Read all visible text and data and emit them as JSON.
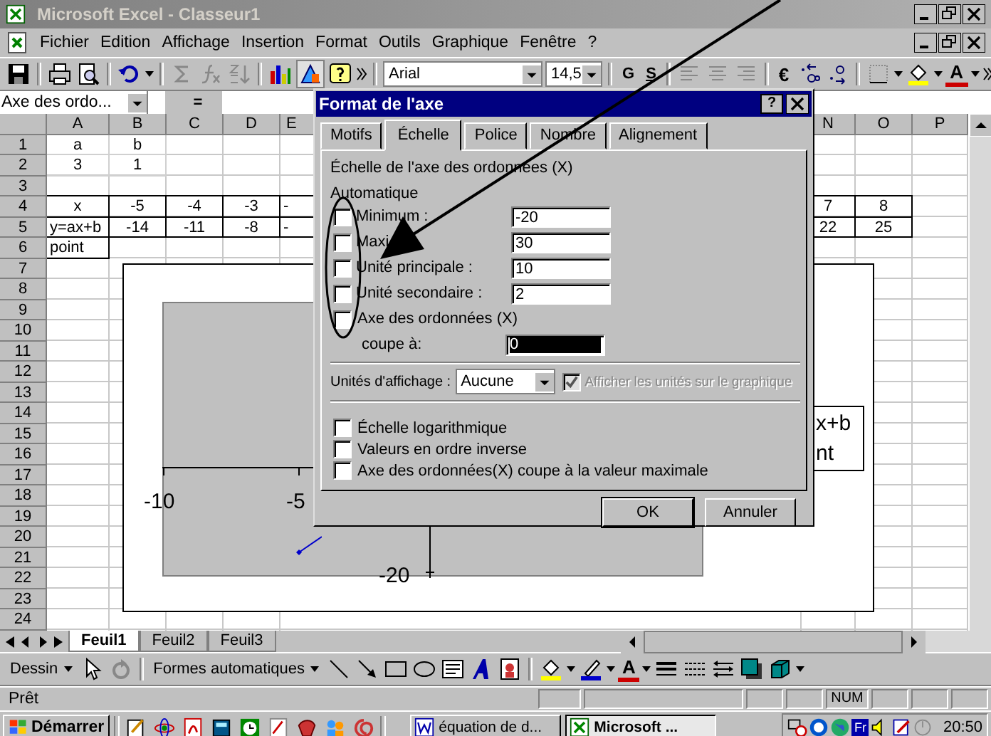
{
  "window": {
    "title": "Microsoft Excel - Classeur1"
  },
  "menu": [
    "Fichier",
    "Edition",
    "Affichage",
    "Insertion",
    "Format",
    "Outils",
    "Graphique",
    "Fenêtre",
    "?"
  ],
  "toolbar": {
    "font": "Arial",
    "size": "14,5",
    "bold": "G",
    "underline": "S",
    "currency": "€",
    "font_color": "A"
  },
  "formula_bar": {
    "name_box": "Axe des ordo...",
    "equals": "="
  },
  "sheet": {
    "columns": [
      "A",
      "B",
      "C",
      "D",
      "E",
      "N",
      "O",
      "P"
    ],
    "rows": [
      {
        "number": "1",
        "cells": {
          "A": {
            "text": "a",
            "bordered": false
          },
          "B": {
            "text": "b",
            "bordered": false
          }
        }
      },
      {
        "number": "2",
        "cells": {
          "A": {
            "text": "3",
            "bordered": false
          },
          "B": {
            "text": "1",
            "bordered": false
          }
        }
      },
      {
        "number": "3"
      },
      {
        "number": "4",
        "cells": {
          "A": {
            "text": "x",
            "bordered": true
          },
          "B": {
            "text": "-5",
            "bordered": true
          },
          "C": {
            "text": "-4",
            "bordered": true
          },
          "D": {
            "text": "-3",
            "bordered": true
          },
          "E": {
            "text": "-",
            "bordered": true
          },
          "N": {
            "text": "7",
            "bordered": true
          },
          "O": {
            "text": "8",
            "bordered": true
          }
        }
      },
      {
        "number": "5",
        "cells": {
          "A": {
            "text": "y=ax+b",
            "bordered": true
          },
          "B": {
            "text": "-14",
            "bordered": true
          },
          "C": {
            "text": "-11",
            "bordered": true
          },
          "D": {
            "text": "-8",
            "bordered": true
          },
          "E": {
            "text": "-",
            "bordered": true
          },
          "N": {
            "text": "22",
            "bordered": true
          },
          "O": {
            "text": "25",
            "bordered": true
          }
        }
      },
      {
        "number": "6",
        "cells": {
          "A": {
            "text": "point",
            "bordered": true
          }
        }
      },
      {
        "number": "7"
      },
      {
        "number": "8"
      },
      {
        "number": "9"
      },
      {
        "number": "10"
      },
      {
        "number": "11"
      },
      {
        "number": "12"
      },
      {
        "number": "13"
      },
      {
        "number": "14"
      },
      {
        "number": "15"
      },
      {
        "number": "16"
      },
      {
        "number": "17"
      },
      {
        "number": "18"
      },
      {
        "number": "19"
      },
      {
        "number": "20"
      },
      {
        "number": "21"
      },
      {
        "number": "22"
      },
      {
        "number": "23"
      },
      {
        "number": "24"
      }
    ]
  },
  "chart": {
    "x_labels": [
      "-10",
      "-5"
    ],
    "y_labels": [
      "-20"
    ],
    "legend": [
      "x+b",
      "nt"
    ]
  },
  "dialog": {
    "title": "Format de l'axe",
    "help": "?",
    "tabs": [
      {
        "label": "Motifs",
        "selected": false
      },
      {
        "label": "Échelle",
        "selected": true
      },
      {
        "label": "Police",
        "selected": false
      },
      {
        "label": "Nombre",
        "selected": false
      },
      {
        "label": "Alignement",
        "selected": false
      }
    ],
    "group_title": "Échelle de l'axe des ordonnées (X)",
    "auto_label": "Automatique",
    "fields": [
      {
        "kind": "input",
        "label": "Minimum :",
        "value": "-20",
        "checked": false
      },
      {
        "kind": "input",
        "label": "Maxi",
        "value": "30",
        "checked": false
      },
      {
        "kind": "input",
        "label": "Unité principale :",
        "value": "10",
        "checked": false
      },
      {
        "kind": "input",
        "label": "Unité secondaire :",
        "value": "2",
        "checked": false
      },
      {
        "kind": "check",
        "label": "Axe des ordonnées (X)",
        "checked": false
      },
      {
        "kind": "crossing",
        "label": "coupe à:",
        "value": "0",
        "selected": true
      }
    ],
    "display_units": {
      "label": "Unités d'affichage :",
      "value": "Aucune",
      "show_label": "Afficher les unités sur le graphique",
      "show_checked": true,
      "show_disabled": true
    },
    "options": [
      {
        "label": "Échelle logarithmique",
        "checked": false
      },
      {
        "label": "Valeurs en ordre inverse",
        "checked": false
      },
      {
        "label": "Axe des ordonnées(X) coupe à la valeur maximale",
        "checked": false
      }
    ],
    "buttons": [
      "OK",
      "Annuler"
    ]
  },
  "sheet_tabs": [
    {
      "label": "Feuil1",
      "selected": true
    },
    {
      "label": "Feuil2",
      "selected": false
    },
    {
      "label": "Feuil3",
      "selected": false
    }
  ],
  "drawing_toolbar": {
    "draw": "Dessin",
    "autoshapes": "Formes automatiques",
    "font_color": "A"
  },
  "status_bar": {
    "status": "Prêt",
    "num": "NUM"
  },
  "taskbar": {
    "start": "Démarrer",
    "tasks": [
      {
        "label": "équation de d...",
        "selected": false
      },
      {
        "label": "Microsoft ...",
        "selected": true
      }
    ],
    "language": "Fr",
    "clock": "20:50"
  }
}
